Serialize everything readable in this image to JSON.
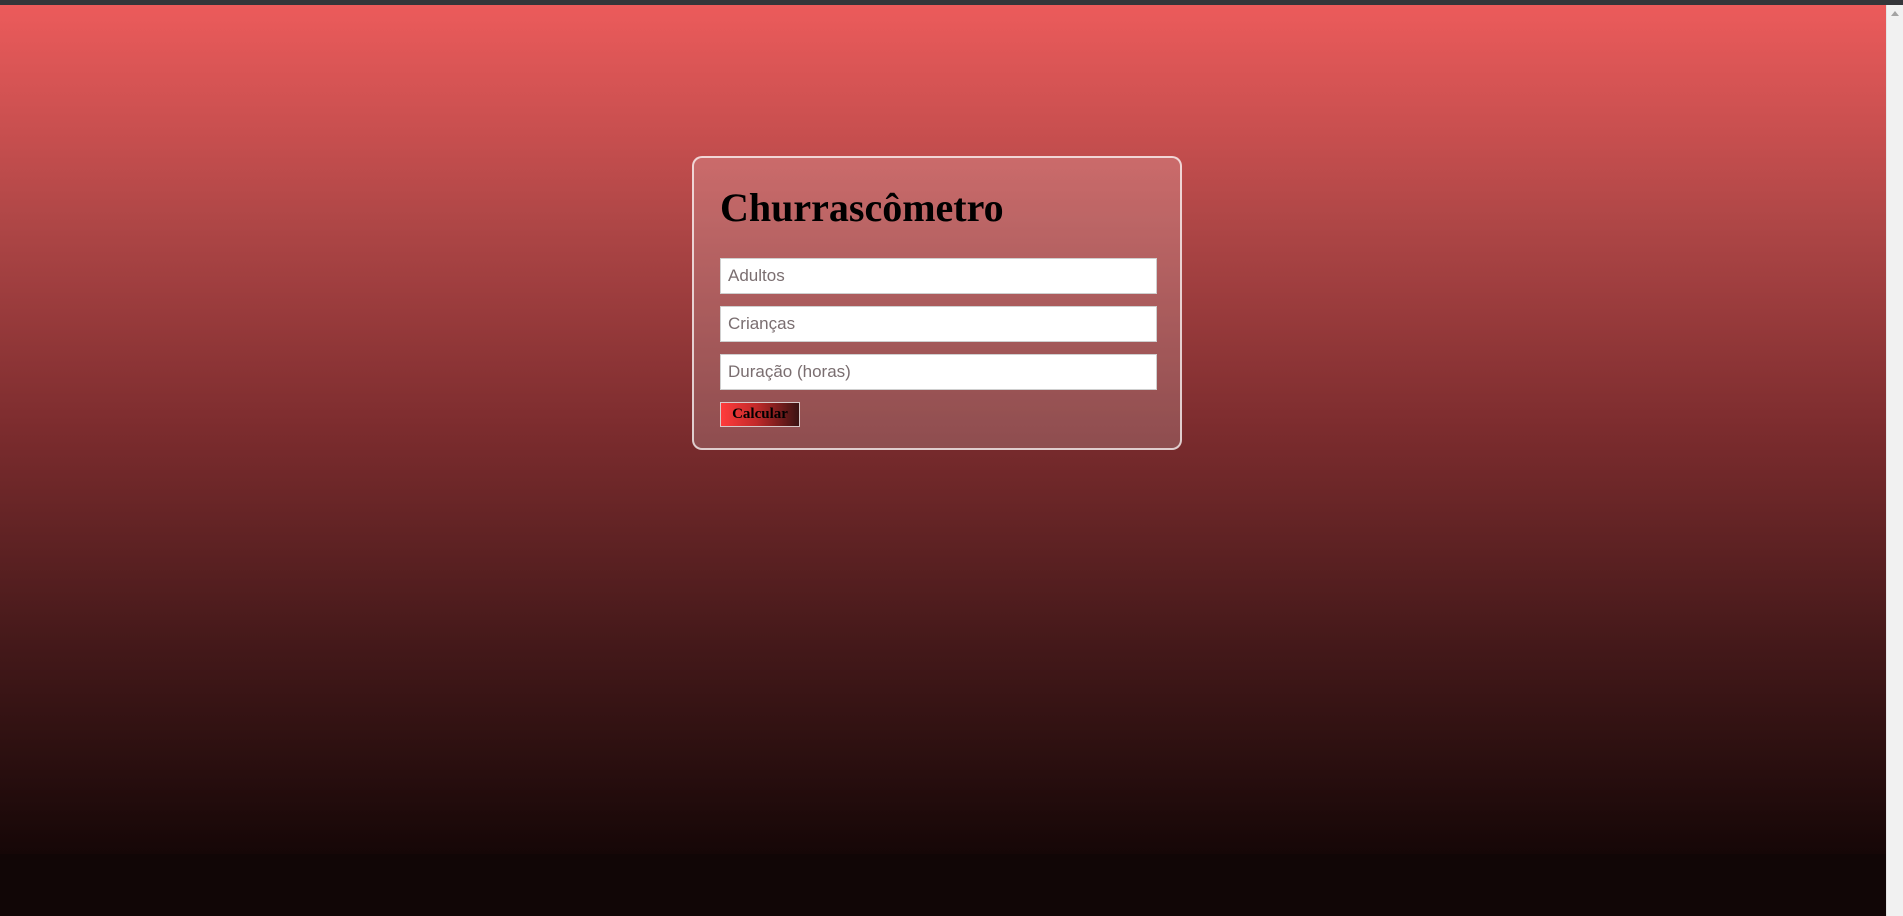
{
  "app": {
    "title": "Churrascômetro"
  },
  "form": {
    "adults_placeholder": "Adultos",
    "children_placeholder": "Crianças",
    "duration_placeholder": "Duração (horas)",
    "submit_label": "Calcular"
  },
  "theme": {
    "gradient_top": "#ec5b5b",
    "gradient_bottom": "#160707",
    "button_gradient_start": "#ff3b3b",
    "button_gradient_end": "#3a1212"
  }
}
